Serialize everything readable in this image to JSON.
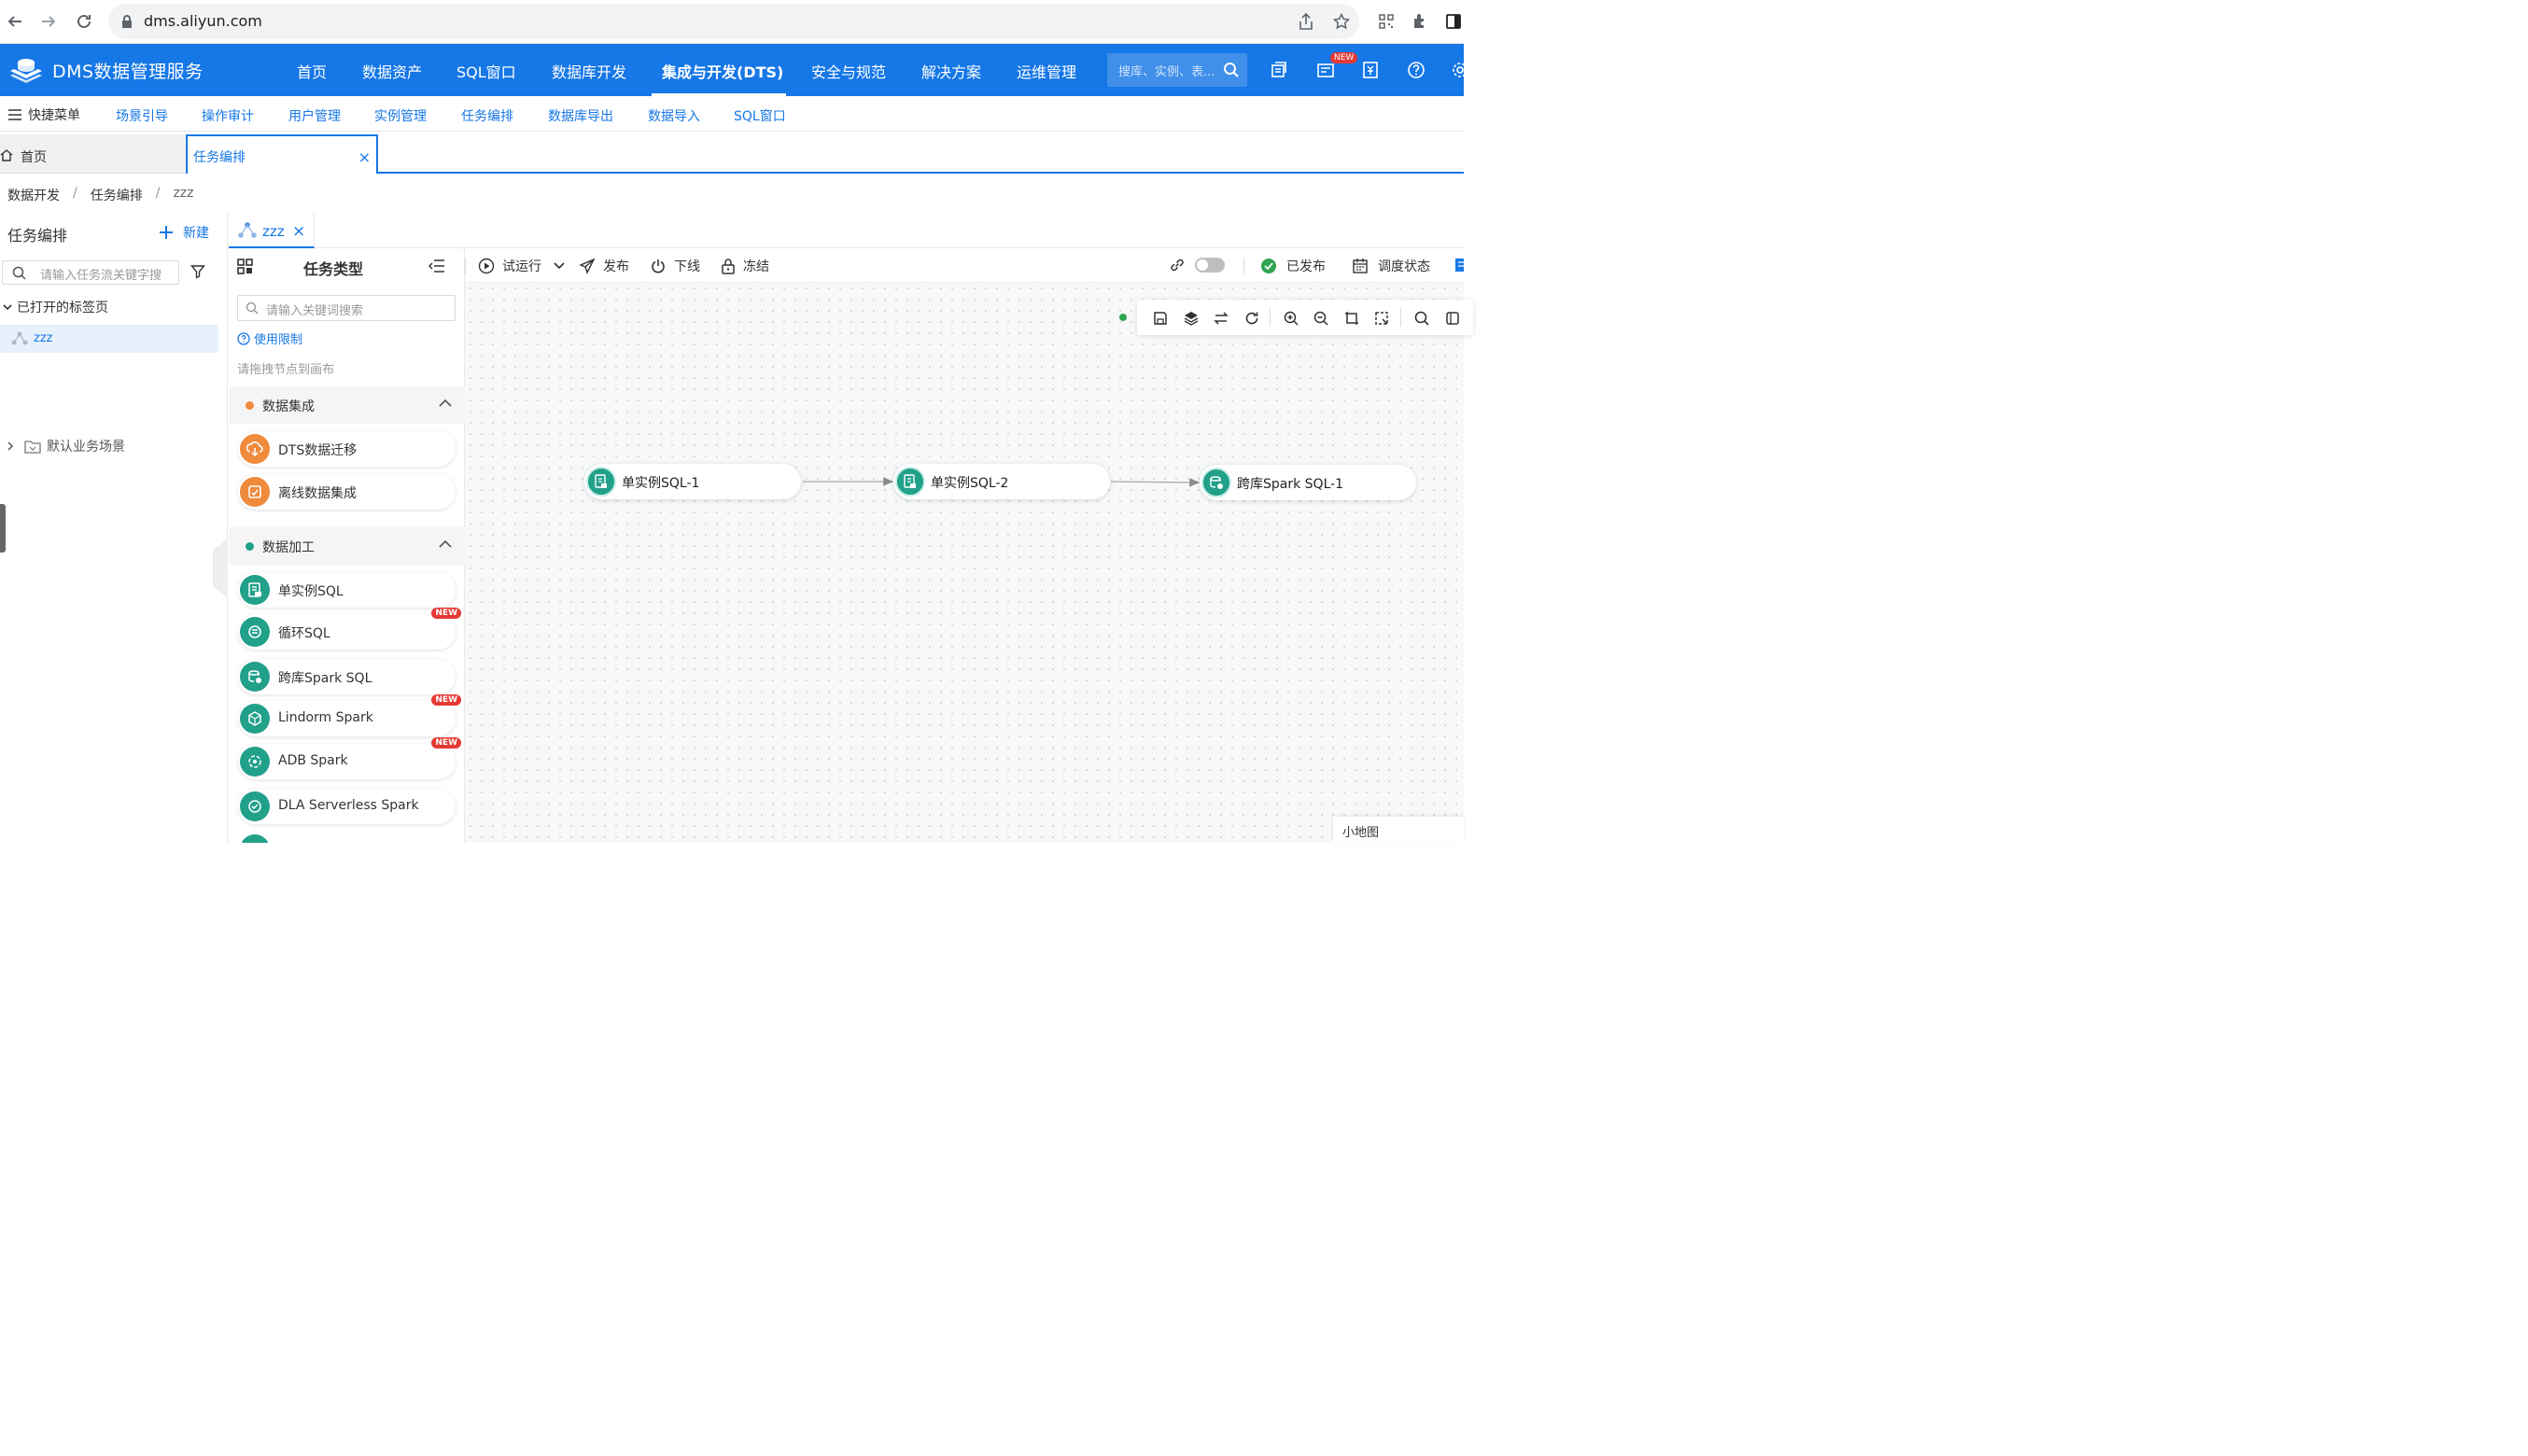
{
  "browser": {
    "url": "dms.aliyun.com"
  },
  "brand": {
    "name": "DMS数据管理服务"
  },
  "topnav": {
    "items": [
      "首页",
      "数据资产",
      "SQL窗口",
      "数据库开发",
      "集成与开发(DTS)",
      "安全与规范",
      "解决方案",
      "运维管理"
    ],
    "active": "集成与开发(DTS)",
    "search_placeholder": "搜库、实例、表...",
    "new_badge": "NEW"
  },
  "quickbar": {
    "menu_label": "快捷菜单",
    "items": [
      "场景引导",
      "操作审计",
      "用户管理",
      "实例管理",
      "任务编排",
      "数据库导出",
      "数据导入",
      "SQL窗口"
    ]
  },
  "pagetabs": {
    "home": "首页",
    "current": "任务编排",
    "close": "×"
  },
  "breadcrumb": [
    "数据开发",
    "任务编排",
    "zzz"
  ],
  "leftpanel": {
    "title": "任务编排",
    "new_label": "新建",
    "search_placeholder": "请输入任务流关键字搜",
    "opened_label": "已打开的标签页",
    "opened_item": "zzz",
    "scene_label": "默认业务场景"
  },
  "editor_tab": {
    "label": "zzz",
    "close": "×"
  },
  "typepanel": {
    "title": "任务类型",
    "search_placeholder": "请输入关键词搜索",
    "limit_link": "使用限制",
    "hint": "请拖拽节点到画布",
    "groups": [
      {
        "label": "数据集成",
        "color": "#f08a3c",
        "items": [
          {
            "label": "DTS数据迁移",
            "new": ""
          },
          {
            "label": "离线数据集成",
            "new": ""
          }
        ]
      },
      {
        "label": "数据加工",
        "color": "#21a08a",
        "items": [
          {
            "label": "单实例SQL",
            "new": ""
          },
          {
            "label": "循环SQL",
            "new": "NEW"
          },
          {
            "label": "跨库Spark SQL",
            "new": ""
          },
          {
            "label": "Lindorm Spark",
            "new": "NEW"
          },
          {
            "label": "ADB Spark",
            "new": "NEW"
          },
          {
            "label": "DLA Serverless Spark",
            "new": ""
          }
        ]
      }
    ]
  },
  "toolbar": {
    "trial_run": "试运行",
    "publish": "发布",
    "offline": "下线",
    "freeze": "冻结",
    "published_status": "已发布",
    "schedule_status": "调度状态"
  },
  "canvas": {
    "nodes": [
      "单实例SQL-1",
      "单实例SQL-2",
      "跨库Spark SQL-1"
    ],
    "minimap_label": "小地图"
  },
  "colors": {
    "primary": "#1677e6",
    "teal": "#21a08a",
    "orange": "#f08a3c",
    "success": "#2da44e"
  }
}
